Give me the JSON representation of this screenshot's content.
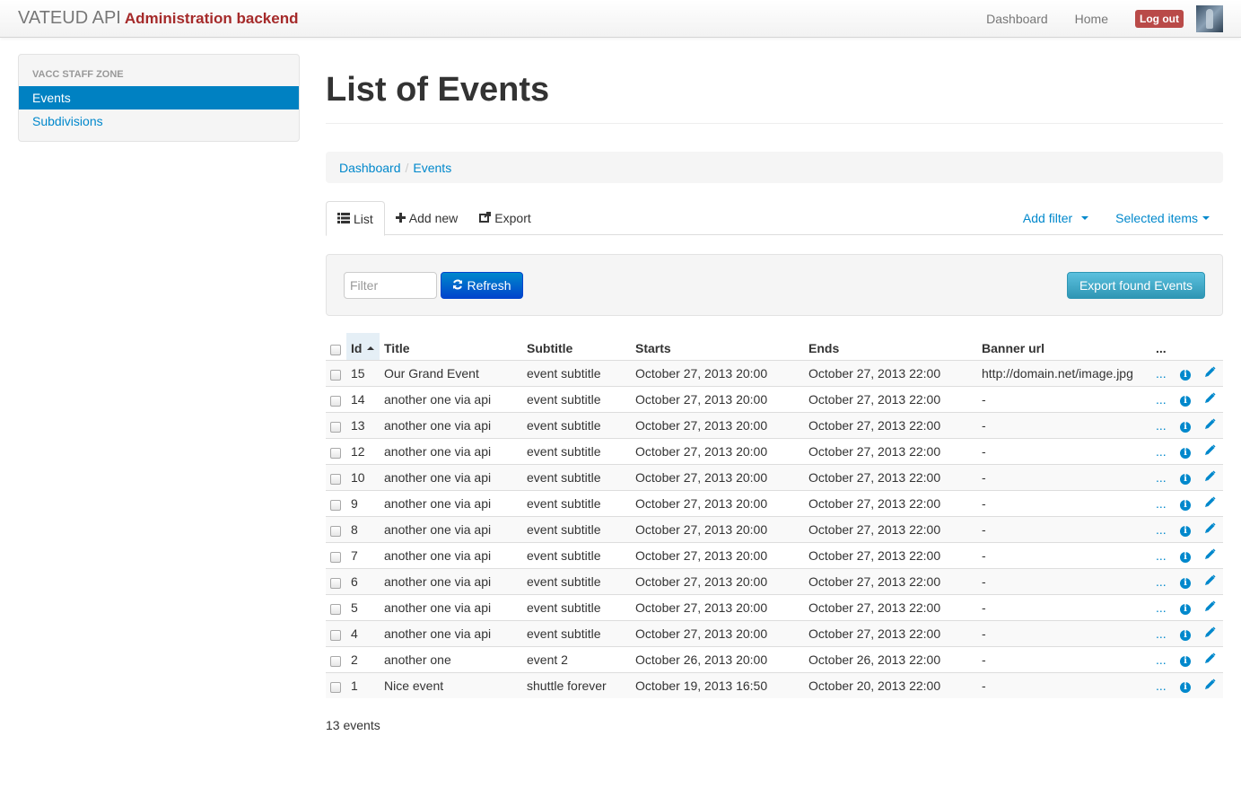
{
  "navbar": {
    "brand": "VATEUD API",
    "subtitle": "Administration backend",
    "links": [
      "Dashboard",
      "Home"
    ],
    "logout": "Log out"
  },
  "sidebar": {
    "header": "VACC STAFF ZONE",
    "items": [
      {
        "label": "Events",
        "active": true
      },
      {
        "label": "Subdivisions",
        "active": false
      }
    ]
  },
  "page": {
    "title": "List of Events",
    "breadcrumb": [
      "Dashboard",
      "Events"
    ],
    "breadcrumb_sep": "/"
  },
  "tabs": {
    "list": "List",
    "add_new": "Add new",
    "export": "Export",
    "add_filter": "Add filter",
    "selected_items": "Selected items"
  },
  "filterbar": {
    "filter_placeholder": "Filter",
    "filter_value": "",
    "refresh": "Refresh",
    "export_found": "Export found Events"
  },
  "table": {
    "columns": [
      "Id",
      "Title",
      "Subtitle",
      "Starts",
      "Ends",
      "Banner url",
      "..."
    ],
    "sorted_column": "Id",
    "sort_direction": "asc",
    "rows": [
      {
        "id": "15",
        "title": "Our Grand Event",
        "subtitle": "event subtitle",
        "starts": "October 27, 2013 20:00",
        "ends": "October 27, 2013 22:00",
        "banner": "http://domain.net/image.jpg"
      },
      {
        "id": "14",
        "title": "another one via api",
        "subtitle": "event subtitle",
        "starts": "October 27, 2013 20:00",
        "ends": "October 27, 2013 22:00",
        "banner": "-"
      },
      {
        "id": "13",
        "title": "another one via api",
        "subtitle": "event subtitle",
        "starts": "October 27, 2013 20:00",
        "ends": "October 27, 2013 22:00",
        "banner": "-"
      },
      {
        "id": "12",
        "title": "another one via api",
        "subtitle": "event subtitle",
        "starts": "October 27, 2013 20:00",
        "ends": "October 27, 2013 22:00",
        "banner": "-"
      },
      {
        "id": "10",
        "title": "another one via api",
        "subtitle": "event subtitle",
        "starts": "October 27, 2013 20:00",
        "ends": "October 27, 2013 22:00",
        "banner": "-"
      },
      {
        "id": "9",
        "title": "another one via api",
        "subtitle": "event subtitle",
        "starts": "October 27, 2013 20:00",
        "ends": "October 27, 2013 22:00",
        "banner": "-"
      },
      {
        "id": "8",
        "title": "another one via api",
        "subtitle": "event subtitle",
        "starts": "October 27, 2013 20:00",
        "ends": "October 27, 2013 22:00",
        "banner": "-"
      },
      {
        "id": "7",
        "title": "another one via api",
        "subtitle": "event subtitle",
        "starts": "October 27, 2013 20:00",
        "ends": "October 27, 2013 22:00",
        "banner": "-"
      },
      {
        "id": "6",
        "title": "another one via api",
        "subtitle": "event subtitle",
        "starts": "October 27, 2013 20:00",
        "ends": "October 27, 2013 22:00",
        "banner": "-"
      },
      {
        "id": "5",
        "title": "another one via api",
        "subtitle": "event subtitle",
        "starts": "October 27, 2013 20:00",
        "ends": "October 27, 2013 22:00",
        "banner": "-"
      },
      {
        "id": "4",
        "title": "another one via api",
        "subtitle": "event subtitle",
        "starts": "October 27, 2013 20:00",
        "ends": "October 27, 2013 22:00",
        "banner": "-"
      },
      {
        "id": "2",
        "title": "another one",
        "subtitle": "event 2",
        "starts": "October 26, 2013 20:00",
        "ends": "October 26, 2013 22:00",
        "banner": "-"
      },
      {
        "id": "1",
        "title": "Nice event",
        "subtitle": "shuttle forever",
        "starts": "October 19, 2013 16:50",
        "ends": "October 20, 2013 22:00",
        "banner": "-"
      }
    ],
    "row_more": "..."
  },
  "footer": {
    "count": "13 events"
  },
  "colors": {
    "brand_accent": "#a52a2a",
    "link": "#0088cc",
    "active_nav": "#0081c2",
    "logout": "#b94a48",
    "refresh": "#0055cc",
    "export": "#49afcd"
  }
}
